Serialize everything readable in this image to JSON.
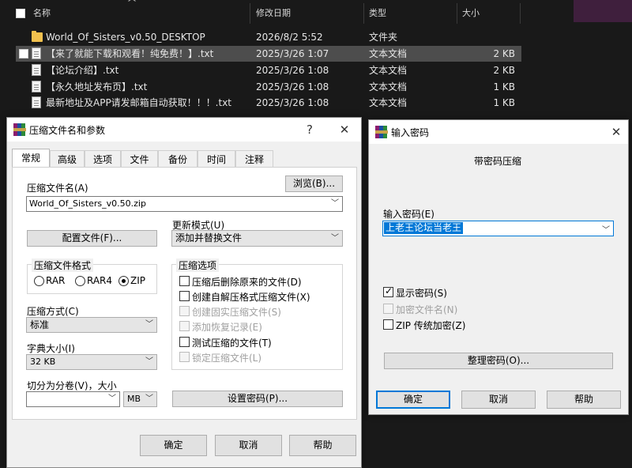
{
  "explorer": {
    "columns": {
      "name": "名称",
      "modified": "修改日期",
      "type": "类型",
      "size": "大小"
    },
    "files": [
      {
        "name": "World_Of_Sisters_v0.50_DESKTOP",
        "modified": "2026/8/2 5:52",
        "type": "文件夹",
        "size": "",
        "icon": "folder-icon"
      },
      {
        "name": "【来了就能下载和观看！纯免费！】.txt",
        "modified": "2025/3/26 1:07",
        "type": "文本文档",
        "size": "2 KB",
        "icon": "text-file-icon"
      },
      {
        "name": "【论坛介绍】.txt",
        "modified": "2025/3/26 1:08",
        "type": "文本文档",
        "size": "2 KB",
        "icon": "text-file-icon"
      },
      {
        "name": "【永久地址发布页】.txt",
        "modified": "2025/3/26 1:08",
        "type": "文本文档",
        "size": "1 KB",
        "icon": "text-file-icon"
      },
      {
        "name": "最新地址及APP请发邮箱自动获取！！！.txt",
        "modified": "2025/3/26 1:08",
        "type": "文本文档",
        "size": "1 KB",
        "icon": "text-file-icon"
      }
    ]
  },
  "archive_dialog": {
    "title": "压缩文件名和参数",
    "help_glyph": "?",
    "close_glyph": "✕",
    "tabs": [
      "常规",
      "高级",
      "选项",
      "文件",
      "备份",
      "时间",
      "注释"
    ],
    "archive_name_label": "压缩文件名(A)",
    "browse_button": "浏览(B)...",
    "archive_name_value": "World_Of_Sisters_v0.50.zip",
    "profiles_button": "配置文件(F)...",
    "update_mode_label": "更新模式(U)",
    "update_mode_value": "添加并替换文件",
    "format_group_title": "压缩文件格式",
    "formats": [
      {
        "label": "RAR",
        "selected": false
      },
      {
        "label": "RAR4",
        "selected": false
      },
      {
        "label": "ZIP",
        "selected": true
      }
    ],
    "method_label": "压缩方式(C)",
    "method_value": "标准",
    "dict_label": "字典大小(I)",
    "dict_value": "32 KB",
    "split_label": "切分为分卷(V)，大小",
    "split_value": "",
    "split_unit": "MB",
    "options_group_title": "压缩选项",
    "options": [
      {
        "label": "压缩后删除原来的文件(D)",
        "checked": false,
        "enabled": true
      },
      {
        "label": "创建自解压格式压缩文件(X)",
        "checked": false,
        "enabled": true
      },
      {
        "label": "创建固实压缩文件(S)",
        "checked": false,
        "enabled": false
      },
      {
        "label": "添加恢复记录(E)",
        "checked": false,
        "enabled": false
      },
      {
        "label": "测试压缩的文件(T)",
        "checked": false,
        "enabled": true
      },
      {
        "label": "锁定压缩文件(L)",
        "checked": false,
        "enabled": false
      }
    ],
    "set_password_button": "设置密码(P)...",
    "ok_button": "确定",
    "cancel_button": "取消",
    "help_button": "帮助"
  },
  "password_dialog": {
    "title": "输入密码",
    "close_glyph": "✕",
    "heading": "带密码压缩",
    "password_label": "输入密码(E)",
    "password_value": "上老王论坛当老王",
    "show_password_label": "显示密码(S)",
    "show_password_checked": true,
    "encrypt_names_label": "加密文件名(N)",
    "encrypt_names_checked": false,
    "zip_legacy_label": "ZIP 传统加密(Z)",
    "zip_legacy_checked": false,
    "organize_button": "整理密码(O)...",
    "ok_button": "确定",
    "cancel_button": "取消",
    "help_button": "帮助"
  }
}
